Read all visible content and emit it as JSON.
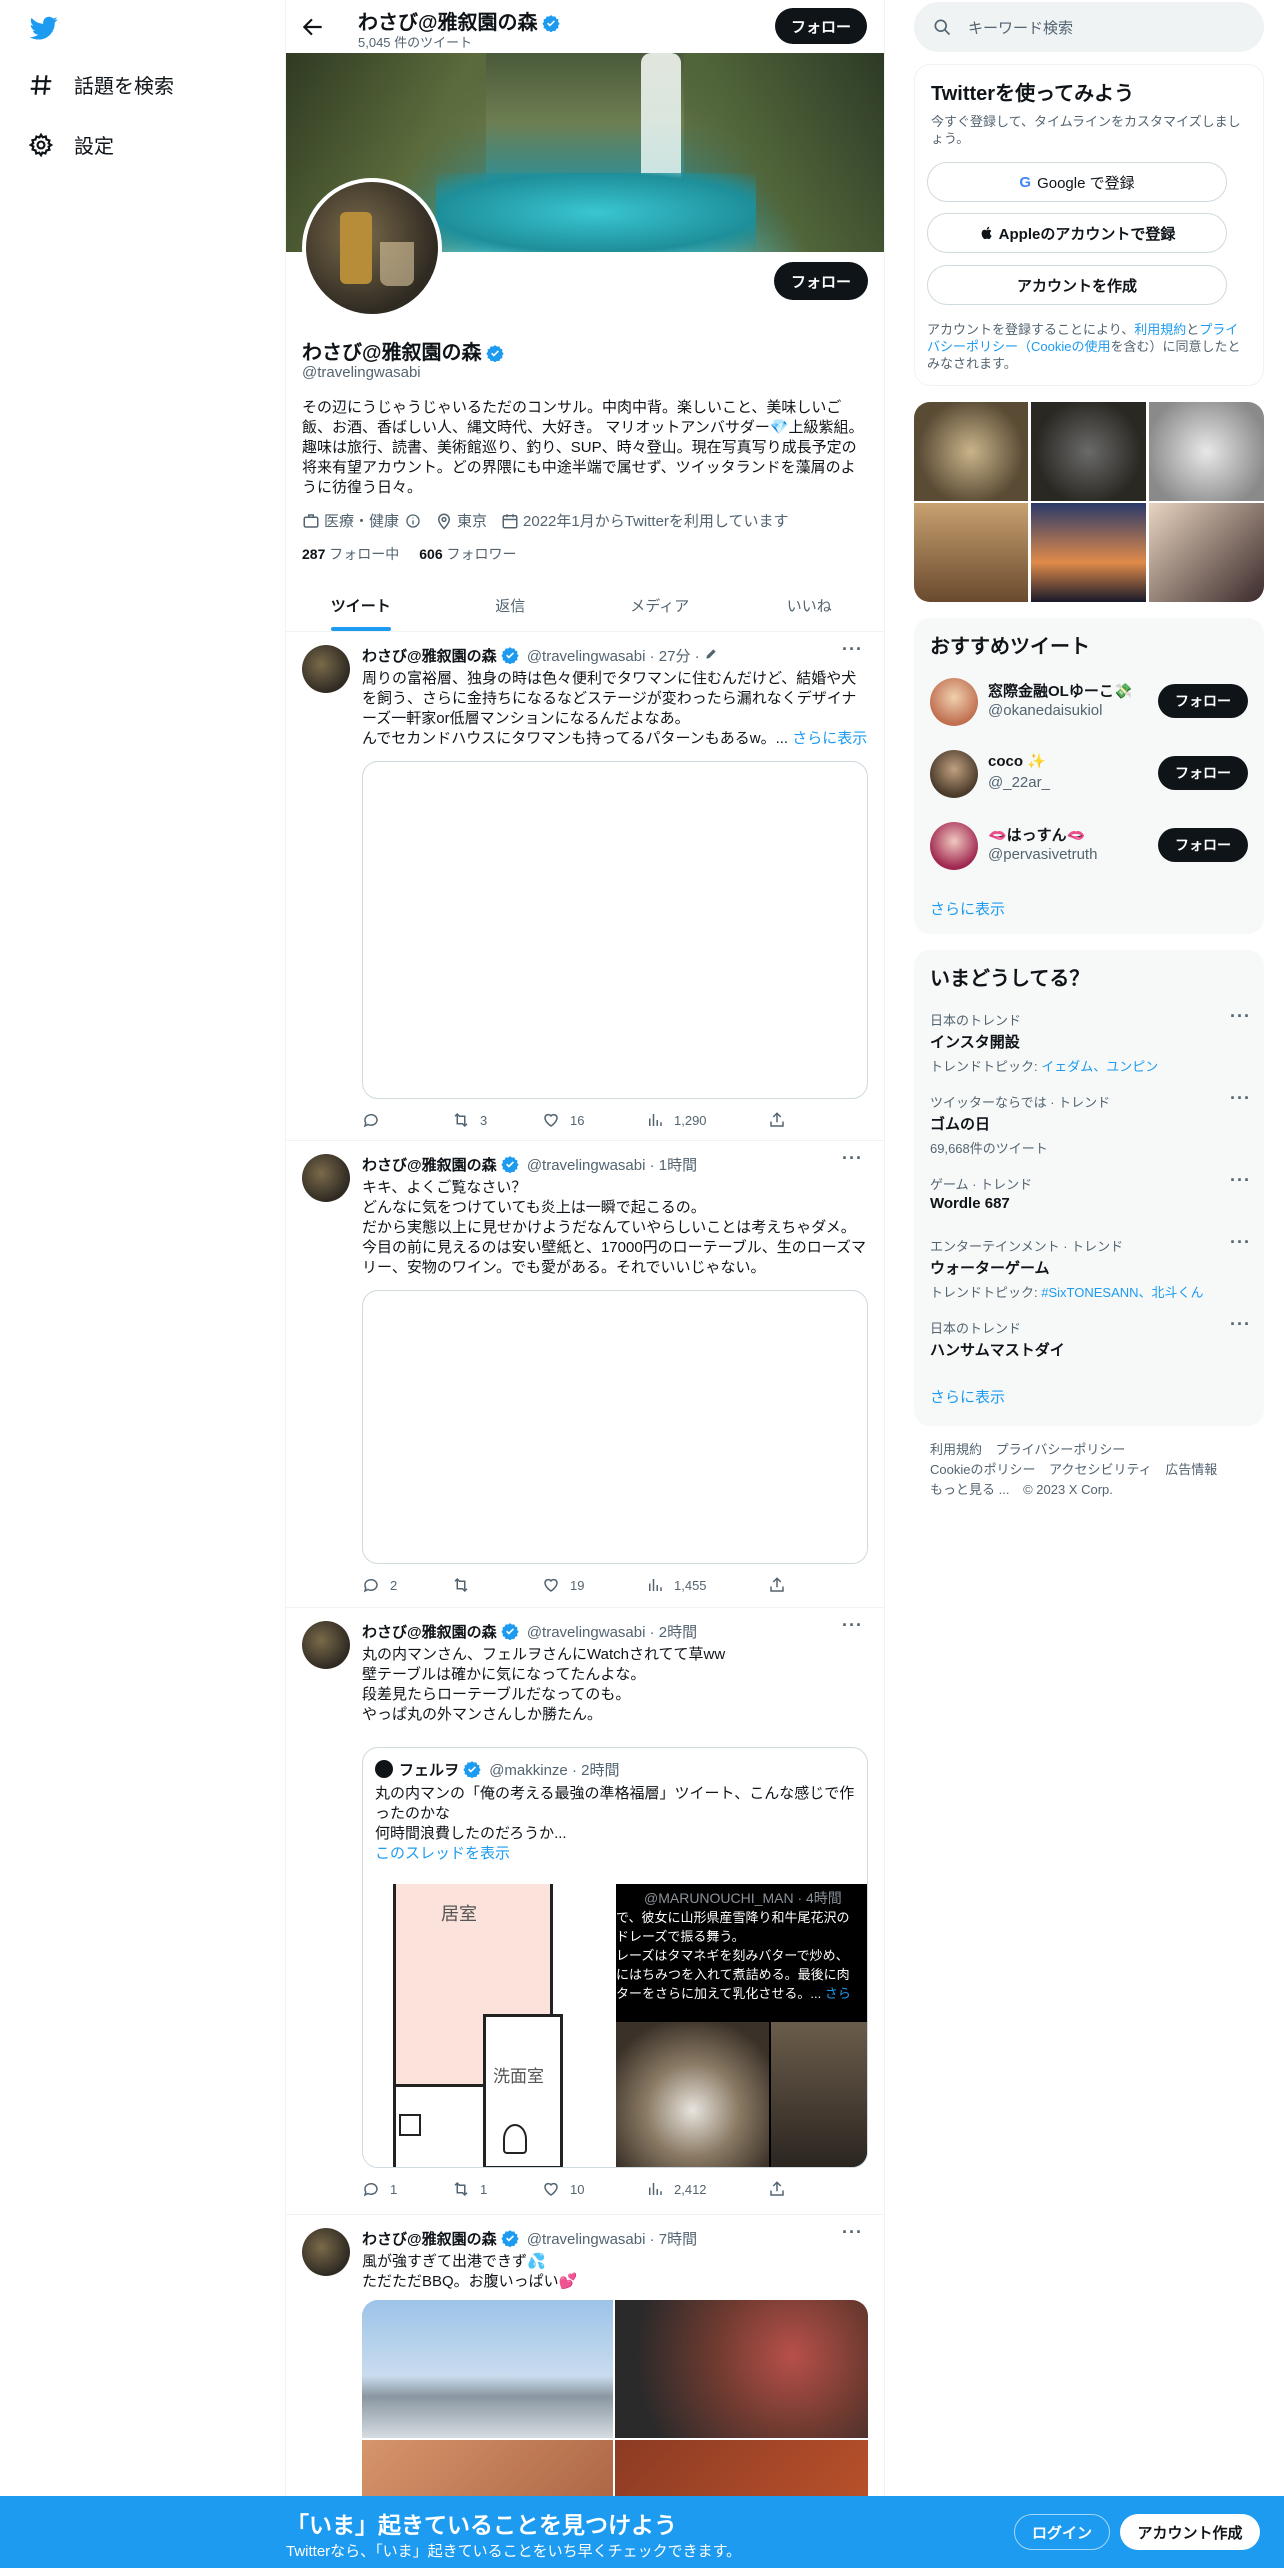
{
  "nav": {
    "items": [
      {
        "label": "話題を検索",
        "icon": "hash-icon"
      },
      {
        "label": "設定",
        "icon": "gear-icon"
      }
    ]
  },
  "header": {
    "title": "わさび@雅叙園の森",
    "tweet_count": "5,045 件のツイート",
    "follow_label": "フォロー"
  },
  "profile": {
    "name": "わさび@雅叙園の森",
    "handle": "@travelingwasabi",
    "follow_label": "フォロー",
    "bio": "その辺にうじゃうじゃいるただのコンサル。中肉中背。楽しいこと、美味しいご飯、お酒、香ばしい人、縄文時代、大好き。 マリオットアンバサダー💎上級紫組。趣味は旅行、読書、美術館巡り、釣り、SUP、時々登山。現在写真写り成長予定の将来有望アカウント。どの界隈にも中途半端で属せず、ツイッタランドを藻屑のように彷徨う日々。",
    "category": "医療・健康",
    "location": "東京",
    "joined": "2022年1月からTwitterを利用しています",
    "following_count": "287",
    "following_label": "フォロー中",
    "followers_count": "606",
    "followers_label": "フォロワー"
  },
  "tabs": [
    "ツイート",
    "返信",
    "メディア",
    "いいね"
  ],
  "tweets": [
    {
      "name": "わさび@雅叙園の森",
      "handle": "@travelingwasabi",
      "time": "· 27分 ·",
      "lines": [
        "周りの富裕層、独身の時は色々便利でタワマンに住むんだけど、結婚や犬",
        "を飼う、さらに金持ちになるなどステージが変わったら漏れなくデザイナ",
        "ーズ一軒家or低層マンションになるんだよなあ。",
        "んでセカンドハウスにタワマンも持ってるパターンもあるw。..."
      ],
      "show_more": "さらに表示",
      "reply": "",
      "retweet": "3",
      "like": "16",
      "views": "1,290"
    },
    {
      "name": "わさび@雅叙園の森",
      "handle": "@travelingwasabi",
      "time": "· 1時間",
      "lines": [
        "キキ、よくご覧なさい？",
        "どんなに気をつけていても炎上は一瞬で起こるの。",
        "だから実態以上に見せかけようだなんていやらしいことは考えちゃダメ。",
        "今目の前に見えるのは安い壁紙と、17000円のローテーブル、生のローズマ",
        "リー、安物のワイン。でも愛がある。それでいいじゃない。"
      ],
      "reply": "2",
      "retweet": "",
      "like": "19",
      "views": "1,455"
    },
    {
      "name": "わさび@雅叙園の森",
      "handle": "@travelingwasabi",
      "time": "· 2時間",
      "lines": [
        "丸の内マンさん、フェルヲさんにWatchされてて草ww",
        "壁テーブルは確かに気になってたんよな。",
        "段差見たらローテーブルだなってのも。",
        "やっぱ丸の外マンさんしか勝たん。"
      ],
      "quote": {
        "name": "フェルヲ",
        "handle": "@makkinze",
        "time": "· 2時間",
        "lines": [
          "丸の内マンの「俺の考える最強の準格福層」ツイート、こんな感じで作",
          "ったのかな",
          "何時間浪費したのだろうか..."
        ],
        "thread_link": "このスレッドを表示",
        "floor_labels": [
          "居室",
          "洗面室"
        ],
        "inner_handle": "@MARUNOUCHI_MAN · 4時間",
        "inner_lines": [
          "で、彼女に山形県産雪降り和牛尾花沢の",
          "ドレーズで振る舞う。",
          "レーズはタマネギを刻みバターで炒め、",
          "にはちみつを入れて煮詰める。最後に肉",
          "ターをさらに加えて乳化させる。..."
        ],
        "inner_more": "さら"
      },
      "reply": "1",
      "retweet": "1",
      "like": "10",
      "views": "2,412"
    },
    {
      "name": "わさび@雅叙園の森",
      "handle": "@travelingwasabi",
      "time": "· 7時間",
      "lines": [
        "風が強すぎて出港できず💦",
        "ただただBBQ。お腹いっぱい💕"
      ]
    }
  ],
  "search": {
    "placeholder": "キーワード検索"
  },
  "signup": {
    "title": "Twitterを使ってみよう",
    "subtitle": "今すぐ登録して、タイムラインをカスタマイズしましょう。",
    "google": "Google で登録",
    "apple": "Appleのアカウントで登録",
    "create": "アカウントを作成",
    "terms_prefix": "アカウントを登録することにより、",
    "terms_link": "利用規約",
    "terms_and": "と",
    "privacy_link": "プライバシーポリシー（Cookieの使用",
    "terms_suffix": "を含む）に同意したとみなされます。"
  },
  "recommended": {
    "title": "おすすめツイート",
    "users": [
      {
        "name": "窓際金融OLゆーこ💸",
        "handle": "@okanedaisukiol",
        "follow": "フォロー"
      },
      {
        "name": "coco ✨",
        "handle": "@_22ar_",
        "follow": "フォロー"
      },
      {
        "name": "🫦はっすん🫦",
        "handle": "@pervasivetruth",
        "follow": "フォロー"
      }
    ],
    "more": "さらに表示"
  },
  "trends": {
    "title": "いまどうしてる？",
    "items": [
      {
        "meta": "日本のトレンド",
        "name": "インスタ開設",
        "sub_prefix": "トレンドトピック: ",
        "sub_links": "イェダム、ユンピン",
        "sub_plain": ""
      },
      {
        "meta": "ツイッターならでは · トレンド",
        "name": "ゴムの日",
        "sub_prefix": "",
        "sub_links": "",
        "sub_plain": "69,668件のツイート"
      },
      {
        "meta": "ゲーム · トレンド",
        "name": "Wordle 687",
        "sub_prefix": "",
        "sub_links": "",
        "sub_plain": ""
      },
      {
        "meta": "エンターテインメント · トレンド",
        "name": "ウォーターゲーム",
        "sub_prefix": "トレンドトピック: ",
        "sub_links": "#SixTONESANN、北斗くん",
        "sub_plain": ""
      },
      {
        "meta": "日本のトレンド",
        "name": "ハンサムマストダイ",
        "sub_prefix": "",
        "sub_links": "",
        "sub_plain": ""
      }
    ],
    "more": "さらに表示"
  },
  "footer": {
    "links": [
      "利用規約",
      "プライバシーポリシー",
      "Cookieのポリシー",
      "アクセシビリティ",
      "広告情報",
      "もっと見る ..."
    ],
    "copyright": "© 2023 X Corp."
  },
  "bottom_bar": {
    "title": "「いま」起きていることを見つけよう",
    "subtitle": "Twitterなら、「いま」起きていることをいち早くチェックできます。",
    "login": "ログイン",
    "signup": "アカウント作成"
  },
  "colors": {
    "accent": "#1d9bf0",
    "dark": "#0f1419",
    "muted": "#536471",
    "verified": "#1d9bf0"
  }
}
